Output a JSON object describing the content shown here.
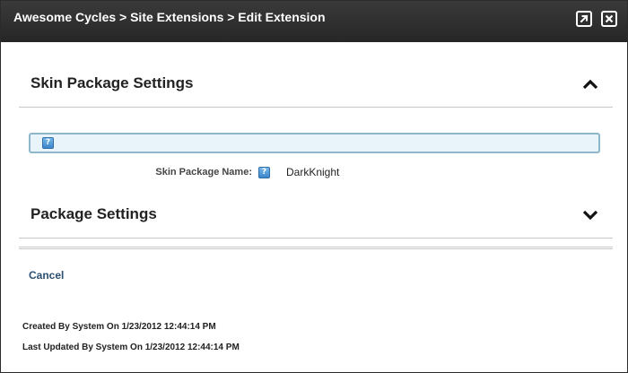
{
  "window": {
    "title": "Awesome Cycles > Site Extensions > Edit Extension",
    "icons": {
      "maximize": "expand-arrow-icon",
      "close": "close-x-icon"
    }
  },
  "sections": {
    "skin": {
      "label": "Skin Package Settings",
      "expanded": true,
      "chevron": "chevron-up-icon"
    },
    "package": {
      "label": "Package Settings",
      "expanded": false,
      "chevron": "chevron-down-icon"
    }
  },
  "info_bar": {
    "help_icon_text": "?"
  },
  "skin_package": {
    "name_label": "Skin Package Name:",
    "help_icon_text": "?",
    "name_value": "DarkKnight"
  },
  "actions": {
    "cancel_label": "Cancel"
  },
  "audit": {
    "created": "Created By System On 1/23/2012 12:44:14 PM",
    "updated": "Last Updated By System On 1/23/2012 12:44:14 PM"
  },
  "colors": {
    "titlebar": "#2f2f2f",
    "info_bar_bg": "#e8f4fa",
    "info_bar_border": "#8fb7cc",
    "link": "#2c4f73",
    "help_icon": "#3b86c9"
  }
}
